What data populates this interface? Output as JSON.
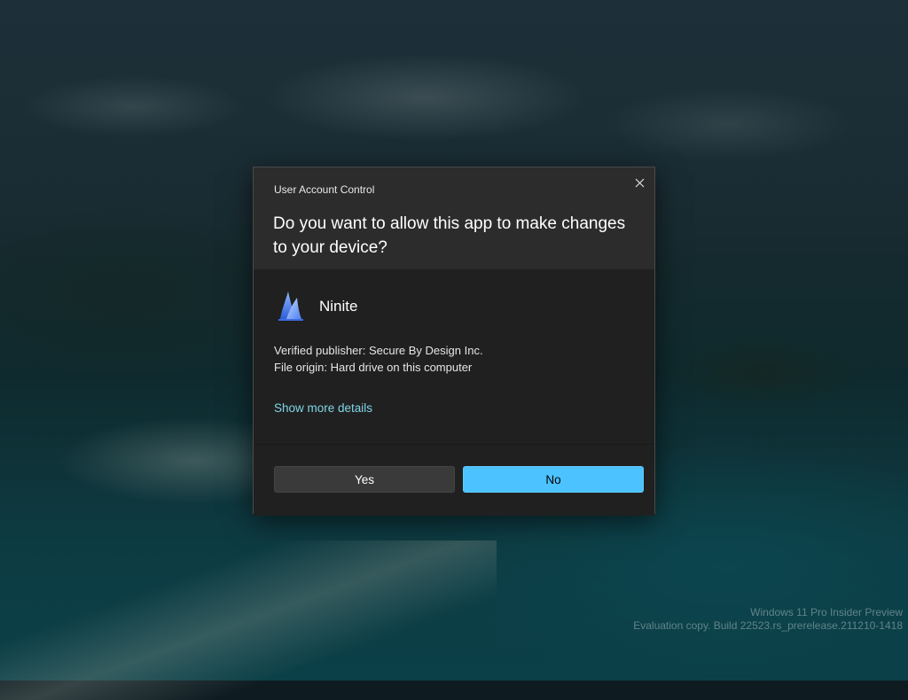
{
  "dialog": {
    "title": "User Account Control",
    "question": "Do you want to allow this app to make changes to your device?",
    "app_name": "Ninite",
    "app_icon": "ninite-icon",
    "publisher": "Verified publisher: Secure By Design Inc.",
    "origin": "File origin: Hard drive on this computer",
    "more_details_label": "Show more details",
    "yes_label": "Yes",
    "no_label": "No",
    "close_icon": "close-icon",
    "accent_color": "#4cc2ff",
    "link_color": "#7fd6e6"
  },
  "watermark": {
    "line1": "Windows 11 Pro Insider Preview",
    "line2": "Evaluation copy. Build 22523.rs_prerelease.211210-1418"
  }
}
